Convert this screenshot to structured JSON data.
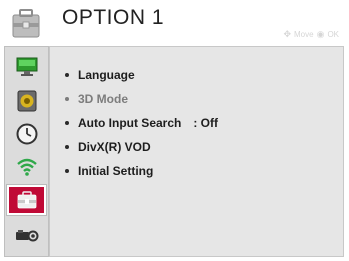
{
  "header": {
    "title": "OPTION 1",
    "hint_move": "Move",
    "hint_ok": "OK"
  },
  "sidebar": {
    "items": [
      {
        "icon": "monitor-icon",
        "active": false
      },
      {
        "icon": "speaker-icon",
        "active": false
      },
      {
        "icon": "clock-icon",
        "active": false
      },
      {
        "icon": "wifi-icon",
        "active": false
      },
      {
        "icon": "toolbox-icon",
        "active": true
      },
      {
        "icon": "camera-support-icon",
        "active": false
      }
    ]
  },
  "menu": {
    "items": [
      {
        "label": "Language",
        "value": "",
        "enabled": true
      },
      {
        "label": "3D Mode",
        "value": "",
        "enabled": false
      },
      {
        "label": "Auto Input Search",
        "value": ": Off",
        "enabled": true
      },
      {
        "label": "DivX(R) VOD",
        "value": "",
        "enabled": true
      },
      {
        "label": "Initial Setting",
        "value": "",
        "enabled": true
      }
    ]
  },
  "colors": {
    "accent_active": "#c00a36",
    "sidebar_bg": "#dcdcdc",
    "content_bg": "#e6e6e6"
  }
}
